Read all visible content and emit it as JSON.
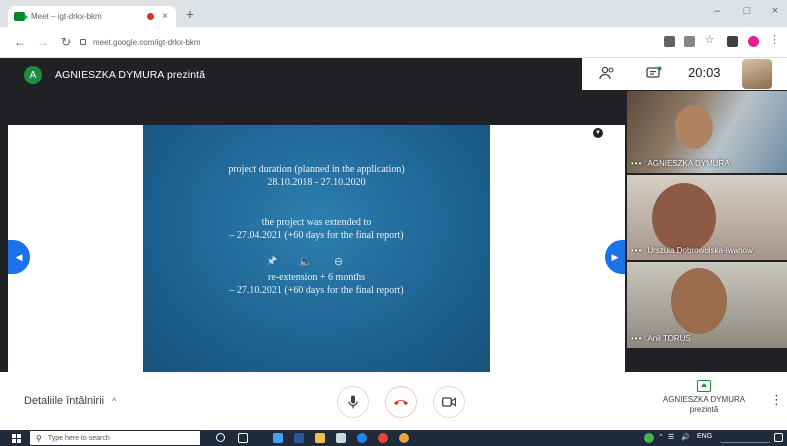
{
  "browser": {
    "tab_title": "Meet – igt-drkx-bkm",
    "tab_close": "×",
    "new_tab": "+",
    "url": "meet.google.com/igt-drkx-bkm",
    "window_controls": [
      "–",
      "□",
      "×"
    ],
    "icons": [
      "meet-favicon-icon",
      "record-icon",
      "back-arrow-icon",
      "forward-arrow-icon",
      "reload-icon",
      "lock-icon",
      "camera-icon",
      "cast-icon",
      "star-icon",
      "extensions-icon",
      "profile-icon",
      "kebab-menu-icon"
    ]
  },
  "meet": {
    "presenter_initial": "A",
    "presenter_title": "AGNIESZKA DYMURA prezintă",
    "clock": "20:03",
    "slide": {
      "block1": [
        "project duration (planned in the application)",
        "28.10.2018 - 27.10.2020"
      ],
      "block2": [
        "the project was extended to",
        "– 27.04.2021 (+60 days for the final report)"
      ],
      "block3": [
        "re-extension + 6 months",
        "– 27.10.2021 (+60 days for the final report)"
      ]
    },
    "participants": [
      {
        "name": "AGNIESZKA DYMURA",
        "dots": "•••"
      },
      {
        "name": "Urszula Dobrowolska-Iwanow",
        "dots": "•••"
      },
      {
        "name": "Anil TORUS",
        "dots": "•••"
      }
    ],
    "colors": {
      "accent": "#1a73e8",
      "end_call": "#d93025",
      "presenting": "#1e8e3e",
      "dark": "#202124"
    }
  },
  "bottom": {
    "details_label": "Detaliile întâlnirii",
    "details_chevron": "^",
    "presenter_name": "AGNIESZKA DYMURA",
    "presenter_status": "prezintă",
    "more": "⋮"
  },
  "taskbar": {
    "search_placeholder": "Type here to search",
    "tray_lang": "ENG"
  }
}
